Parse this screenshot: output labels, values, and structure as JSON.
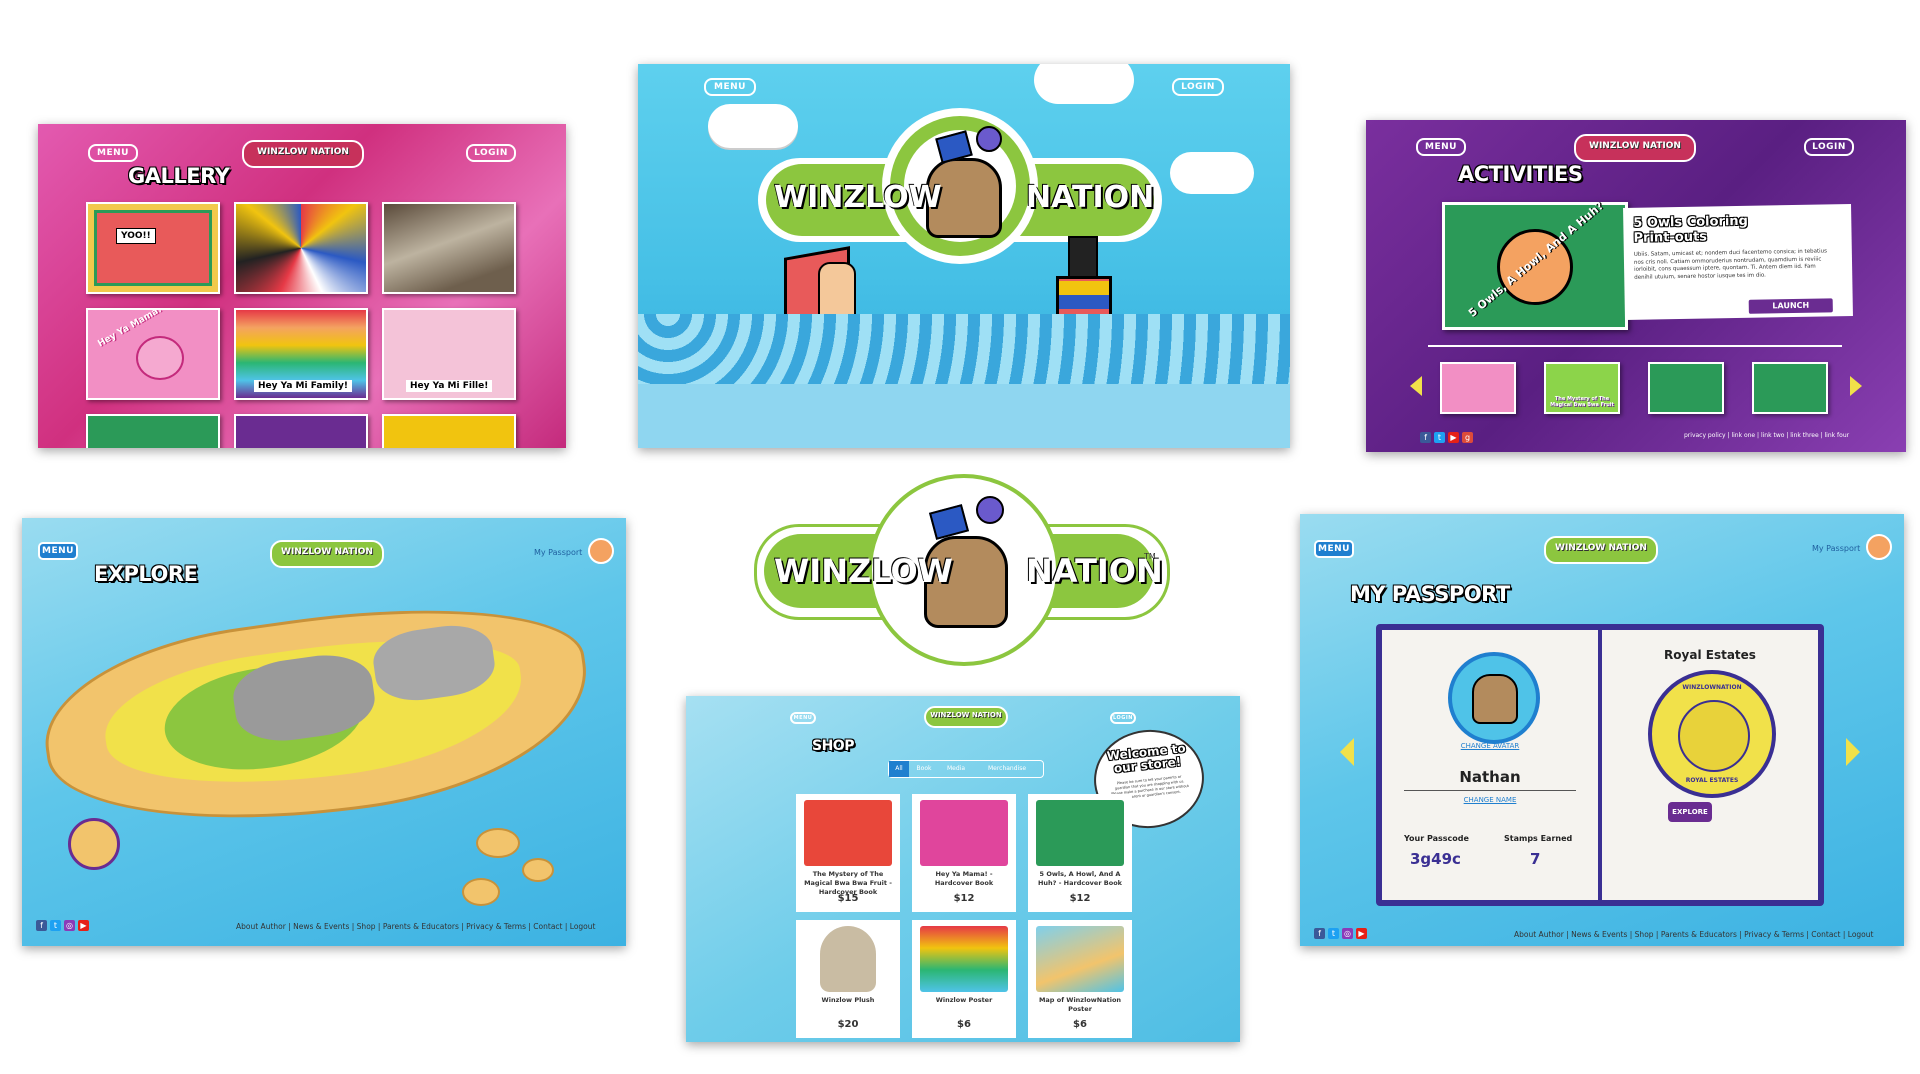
{
  "colors": {
    "green": "#8cc63f",
    "pink": "#e0459c",
    "purple": "#6a2c91",
    "sky": "#4fc3e8",
    "lightblue": "#7fd0ec"
  },
  "hero": {
    "menu": "MENU",
    "login": "LOGIN",
    "logo_left": "WINZLOW",
    "logo_right": "NATION"
  },
  "gallery": {
    "menu": "MENU",
    "login": "LOGIN",
    "logo": "WINZLOW NATION",
    "title": "GALLERY",
    "captions": [
      "YOO!!",
      "Hey Ya Mama!",
      "Hey Ya Mi Family!",
      "Hey Ya Mi Fille!"
    ]
  },
  "activities": {
    "menu": "MENU",
    "login": "LOGIN",
    "logo": "WINZLOW NATION",
    "title": "ACTIVITIES",
    "feature_title": "5 Owls Coloring Print-outs",
    "feature_text": "Ubiis. Satam, umicast et; nondem duci facentemo consica; in tebatius nos cris noli. Catiam ommoruderius nontrudam, quamdium is reviiic iorloibit, cons quaessum iptere, quontam. Ti. Antem diem iid. Fam denihil utuium, senare hostor iusque tes im dio.",
    "launch": "LAUNCH",
    "art_text": "5 Owls, A Howl, And A Huh?",
    "thumb_text": "The Mystery of The Magical Bwa Bwa Fruit",
    "footer_links": [
      "privacy policy",
      "link one",
      "link two",
      "link three",
      "link four"
    ]
  },
  "center_logo": {
    "left": "WINZLOW",
    "right": "NATION",
    "tm": "TM"
  },
  "explore": {
    "menu": "MENU",
    "logo": "WINZLOW NATION",
    "title": "EXPLORE",
    "passport": "My Passport",
    "footer": "About Author | News & Events | Shop | Parents & Educators | Privacy & Terms | Contact | Logout"
  },
  "shop": {
    "menu": "MENU",
    "login": "LOGIN",
    "logo": "WINZLOW NATION",
    "title": "SHOP",
    "filters": [
      "All",
      "Book",
      "Media",
      "Merchandise"
    ],
    "welcome": "Welcome to our store!",
    "welcome_sub": "Please be sure to tell your parents or guardian that you are shopping with us. Please make a purchase in our store without your parent or guardian's consent.",
    "products": [
      {
        "name": "The Mystery of The Magical Bwa Bwa Fruit - Hardcover Book",
        "price": "$15",
        "color": "#e8473a"
      },
      {
        "name": "Hey Ya Mama! - Hardcover Book",
        "price": "$12",
        "color": "#e0459c"
      },
      {
        "name": "5 Owls, A Howl, And A Huh? - Hardcover Book",
        "price": "$12",
        "color": "#2b9a58"
      },
      {
        "name": "Winzlow Plush",
        "price": "$20",
        "color": "#b8a88c"
      },
      {
        "name": "Winzlow Poster",
        "price": "$6",
        "color": "#f4b400"
      },
      {
        "name": "Map of WinzlowNation Poster",
        "price": "$6",
        "color": "#4fc3e8"
      }
    ]
  },
  "passport": {
    "menu": "MENU",
    "logo": "WINZLOW NATION",
    "title": "MY PASSPORT",
    "link": "My Passport",
    "change_avatar": "CHANGE AVATAR",
    "name": "Nathan",
    "change_name": "CHANGE NAME",
    "passcode_label": "Your Passcode",
    "passcode": "3g49c",
    "stamps_label": "Stamps Earned",
    "stamps": "7",
    "estate": "Royal Estates",
    "explore": "EXPLORE",
    "seal_top": "WINZLOWNATION",
    "seal_bottom": "ROYAL ESTATES",
    "footer": "About Author | News & Events | Shop | Parents & Educators | Privacy & Terms | Contact | Logout"
  }
}
